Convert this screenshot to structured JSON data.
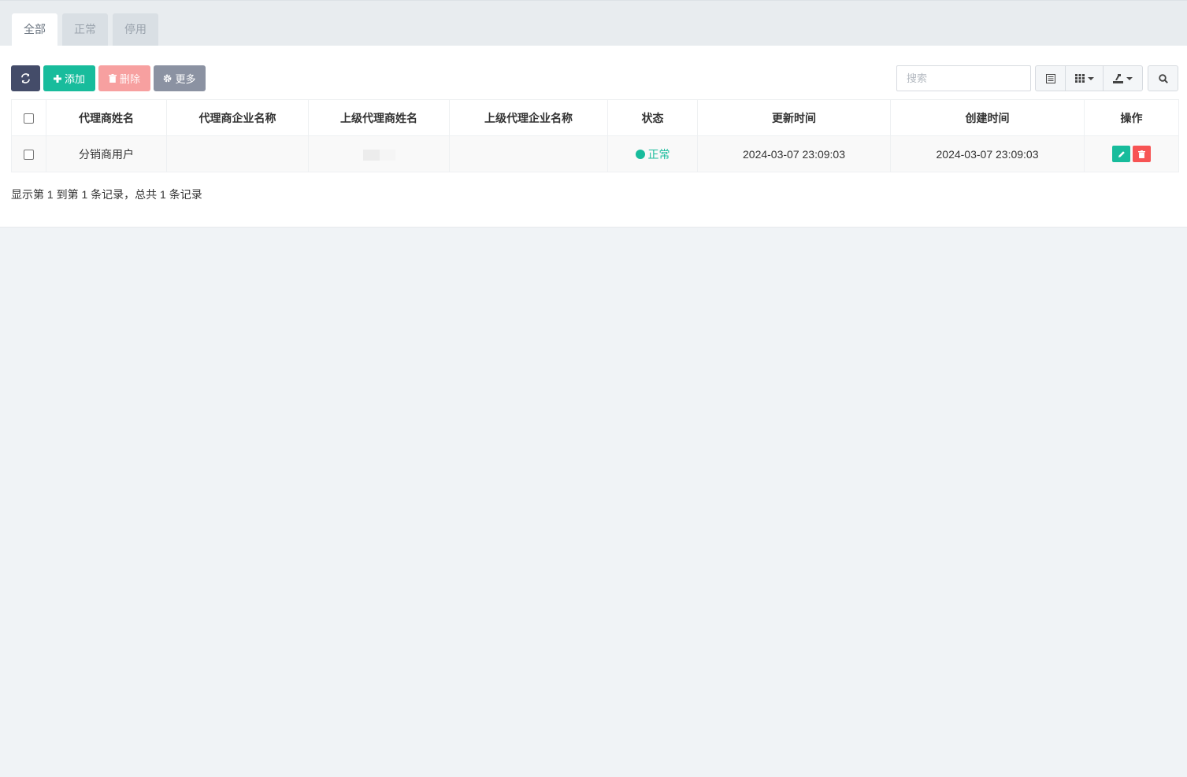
{
  "tabs": [
    {
      "label": "全部",
      "active": true
    },
    {
      "label": "正常",
      "active": false
    },
    {
      "label": "停用",
      "active": false
    }
  ],
  "toolbar": {
    "refresh_icon": "refresh-icon",
    "add_label": "添加",
    "delete_label": "删除",
    "more_label": "更多",
    "search_placeholder": "搜索"
  },
  "table": {
    "headers": [
      "代理商姓名",
      "代理商企业名称",
      "上级代理商姓名",
      "上级代理企业名称",
      "状态",
      "更新时间",
      "创建时间",
      "操作"
    ],
    "rows": [
      {
        "agent_name": "分销商用户",
        "agent_company": "",
        "parent_agent_name": "",
        "parent_company": "",
        "status": "正常",
        "updated_at": "2024-03-07 23:09:03",
        "created_at": "2024-03-07 23:09:03"
      }
    ]
  },
  "pagination": {
    "info": "显示第 1 到第 1 条记录，总共 1 条记录"
  },
  "colors": {
    "primary": "#18bc9c",
    "danger": "#f75454",
    "dark": "#444c69",
    "muted": "#8b92a2"
  }
}
